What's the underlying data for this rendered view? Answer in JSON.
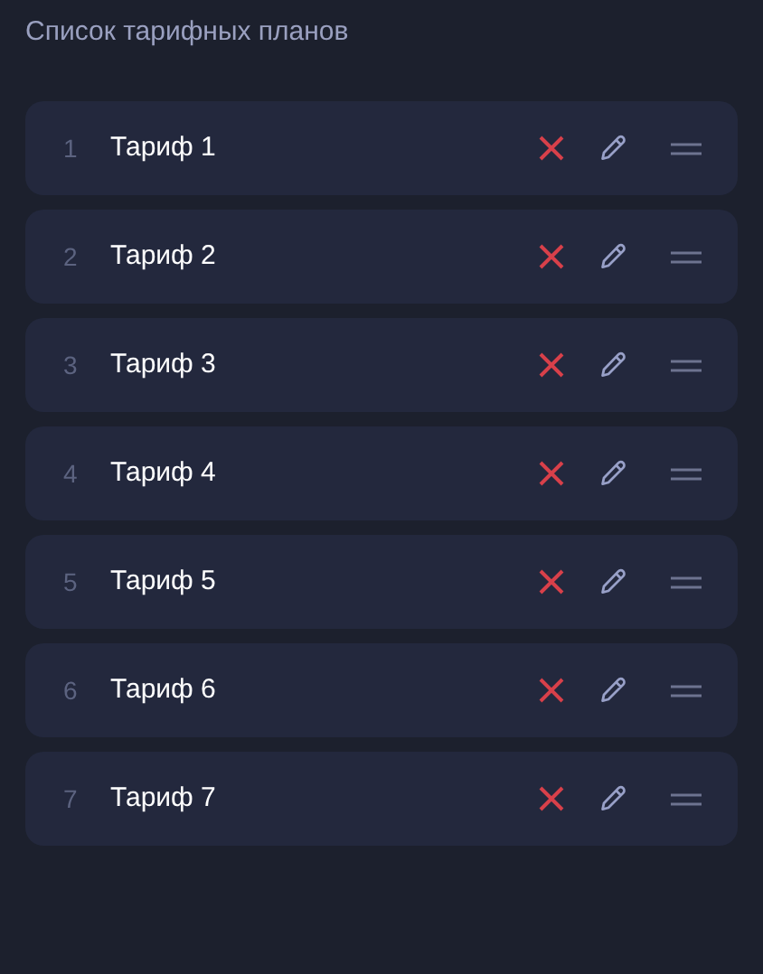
{
  "title": "Список тарифных планов",
  "plans": [
    {
      "number": "1",
      "name": "Тариф 1"
    },
    {
      "number": "2",
      "name": "Тариф 2"
    },
    {
      "number": "3",
      "name": "Тариф 3"
    },
    {
      "number": "4",
      "name": "Тариф 4"
    },
    {
      "number": "5",
      "name": "Тариф 5"
    },
    {
      "number": "6",
      "name": "Тариф 6"
    },
    {
      "number": "7",
      "name": "Тариф 7"
    }
  ]
}
